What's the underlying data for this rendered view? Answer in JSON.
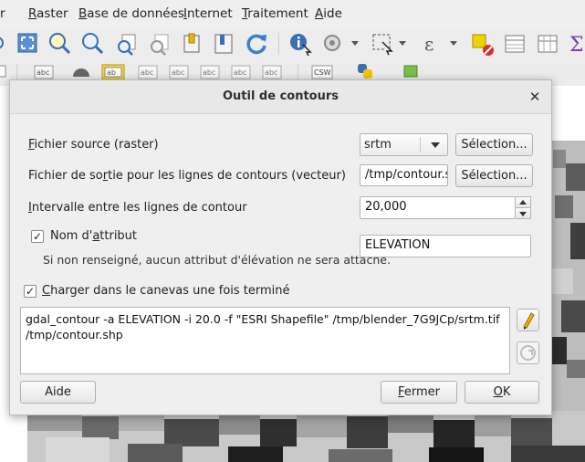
{
  "menubar": {
    "items": [
      {
        "label": "r",
        "underline": ""
      },
      {
        "label": "aster",
        "underline": "R"
      },
      {
        "label": "ase de données",
        "underline": "B"
      },
      {
        "label": "nternet",
        "underline": "I"
      },
      {
        "label": "raitement",
        "underline": "T"
      },
      {
        "label": "ide",
        "underline": "A"
      }
    ]
  },
  "toolbar2": {
    "csw_label": "CSW",
    "abc_label": "abc"
  },
  "dialog": {
    "title": "Outil de contours",
    "close_glyph": "✕",
    "source": {
      "label_u": "F",
      "label_rest": "ichier source (raster)",
      "value": "srtm",
      "select_button": "Sélection..."
    },
    "output": {
      "label_a": "Fichier de so",
      "label_u": "r",
      "label_b": "tie pour les lignes de contours (vecteur)",
      "value": "/tmp/contour.sh",
      "select_button": "Sélection..."
    },
    "interval": {
      "label_u": "I",
      "label_rest": "ntervalle entre les lignes de contour",
      "value": "20,000"
    },
    "attribute": {
      "checked": true,
      "label_a": "Nom d'",
      "label_u": "a",
      "label_b": "ttribut",
      "hint": "Si non renseigné, aucun attribut d'élévation ne sera attaché.",
      "value": "ELEVATION"
    },
    "load_canvas": {
      "checked": true,
      "label_u": "C",
      "label_rest": "harger dans le canevas une fois terminé"
    },
    "command": {
      "line1": "gdal_contour -a ELEVATION -i 20.0 -f \"ESRI Shapefile\" /tmp/blender_7G9JCp/srtm.tif",
      "line2": "/tmp/contour.shp"
    },
    "buttons": {
      "help": "Aide",
      "close_u": "F",
      "close_rest": "ermer",
      "ok_u": "O",
      "ok_rest": "K"
    }
  },
  "colors": {
    "dialog_bg": "#efefef",
    "titlebar_bg": "#e8e8e8",
    "edit_icon": "#f0b400"
  }
}
